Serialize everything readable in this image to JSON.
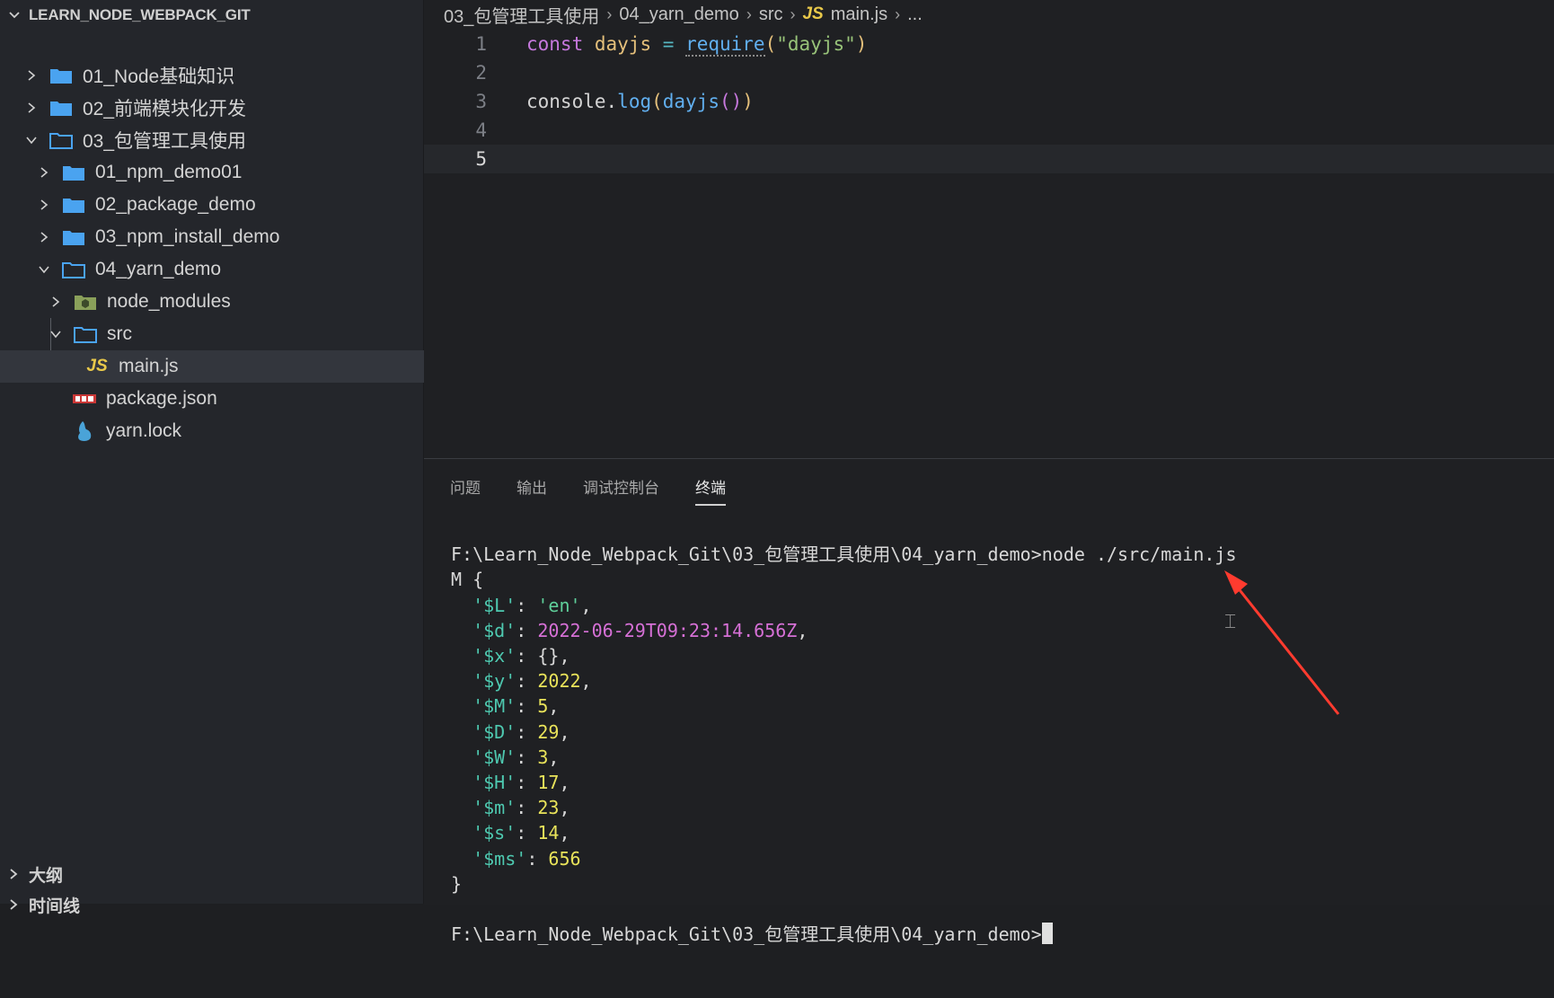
{
  "explorer": {
    "title": "LEARN_NODE_WEBPACK_GIT",
    "items": [
      {
        "label": "01_Node基础知识"
      },
      {
        "label": "02_前端模块化开发"
      },
      {
        "label": "03_包管理工具使用"
      },
      {
        "label": "01_npm_demo01"
      },
      {
        "label": "02_package_demo"
      },
      {
        "label": "03_npm_install_demo"
      },
      {
        "label": "04_yarn_demo"
      },
      {
        "label": "node_modules"
      },
      {
        "label": "src"
      },
      {
        "label": "main.js"
      },
      {
        "label": "package.json"
      },
      {
        "label": "yarn.lock"
      }
    ],
    "outline_label": "大纲",
    "timeline_label": "时间线"
  },
  "breadcrumb": {
    "items": [
      "03_包管理工具使用",
      "04_yarn_demo",
      "src",
      "main.js",
      "..."
    ],
    "js_badge": "JS"
  },
  "editor": {
    "line_numbers": [
      "1",
      "2",
      "3",
      "4",
      "5"
    ],
    "line1": {
      "kw": "const",
      "var": "dayjs",
      "op": "=",
      "fn": "require",
      "open": "(",
      "str": "\"dayjs\"",
      "close": ")"
    },
    "line3": {
      "obj": "console",
      "dot": ".",
      "fn": "log",
      "open": "(",
      "arg": "dayjs",
      "inner": "()",
      "close": ")"
    }
  },
  "panel": {
    "tabs": [
      "问题",
      "输出",
      "调试控制台",
      "终端"
    ],
    "active_tab": "终端",
    "terminal": {
      "command_line": "F:\\Learn_Node_Webpack_Git\\03_包管理工具使用\\04_yarn_demo>node ./src/main.js",
      "open": "M {",
      "entries": [
        {
          "key": "'$L'",
          "value": "'en'",
          "kind": "str",
          "comma": ","
        },
        {
          "key": "'$d'",
          "value": "2022-06-29T09:23:14.656Z",
          "kind": "date",
          "comma": ","
        },
        {
          "key": "'$x'",
          "value": "{}",
          "kind": "plain",
          "comma": ","
        },
        {
          "key": "'$y'",
          "value": "2022",
          "kind": "num",
          "comma": ","
        },
        {
          "key": "'$M'",
          "value": "5",
          "kind": "num",
          "comma": ","
        },
        {
          "key": "'$D'",
          "value": "29",
          "kind": "num",
          "comma": ","
        },
        {
          "key": "'$W'",
          "value": "3",
          "kind": "num",
          "comma": ","
        },
        {
          "key": "'$H'",
          "value": "17",
          "kind": "num",
          "comma": ","
        },
        {
          "key": "'$m'",
          "value": "23",
          "kind": "num",
          "comma": ","
        },
        {
          "key": "'$s'",
          "value": "14",
          "kind": "num",
          "comma": ","
        },
        {
          "key": "'$ms'",
          "value": "656",
          "kind": "num",
          "comma": ""
        }
      ],
      "close": "}",
      "prompt": "F:\\Learn_Node_Webpack_Git\\03_包管理工具使用\\04_yarn_demo>"
    }
  },
  "colors": {
    "accent": "#e8c84a",
    "annotation_arrow": "#ff3b2f"
  }
}
